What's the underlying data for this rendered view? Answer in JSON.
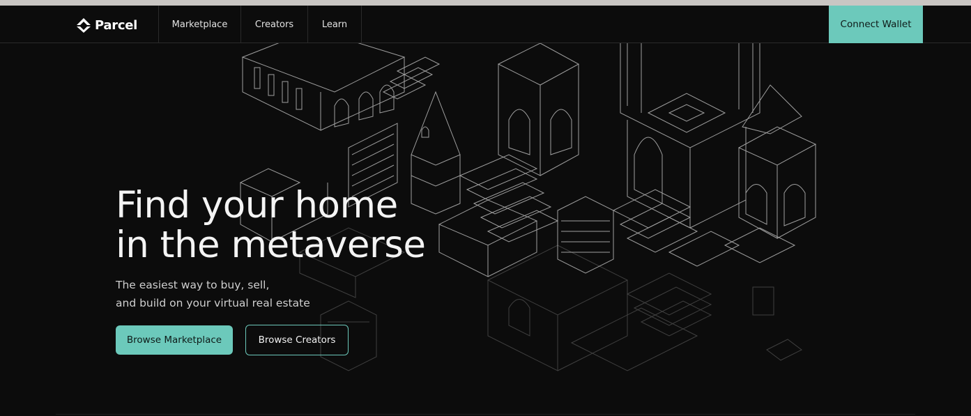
{
  "nav": {
    "logo_text": "Parcel",
    "items": [
      {
        "label": "Marketplace"
      },
      {
        "label": "Creators"
      },
      {
        "label": "Learn"
      }
    ],
    "connect_label": "Connect Wallet"
  },
  "hero": {
    "title_line1": "Find your home",
    "title_line2": "in the metaverse",
    "subtitle_line1": "The easiest way to buy, sell,",
    "subtitle_line2": "and build on your virtual real estate",
    "primary_button": "Browse Marketplace",
    "secondary_button": "Browse Creators"
  },
  "colors": {
    "background": "#0c0c0c",
    "accent": "#6cc9bb",
    "text": "#f4f4f4"
  },
  "icons": {
    "logo": "parcel-logo-icon"
  }
}
